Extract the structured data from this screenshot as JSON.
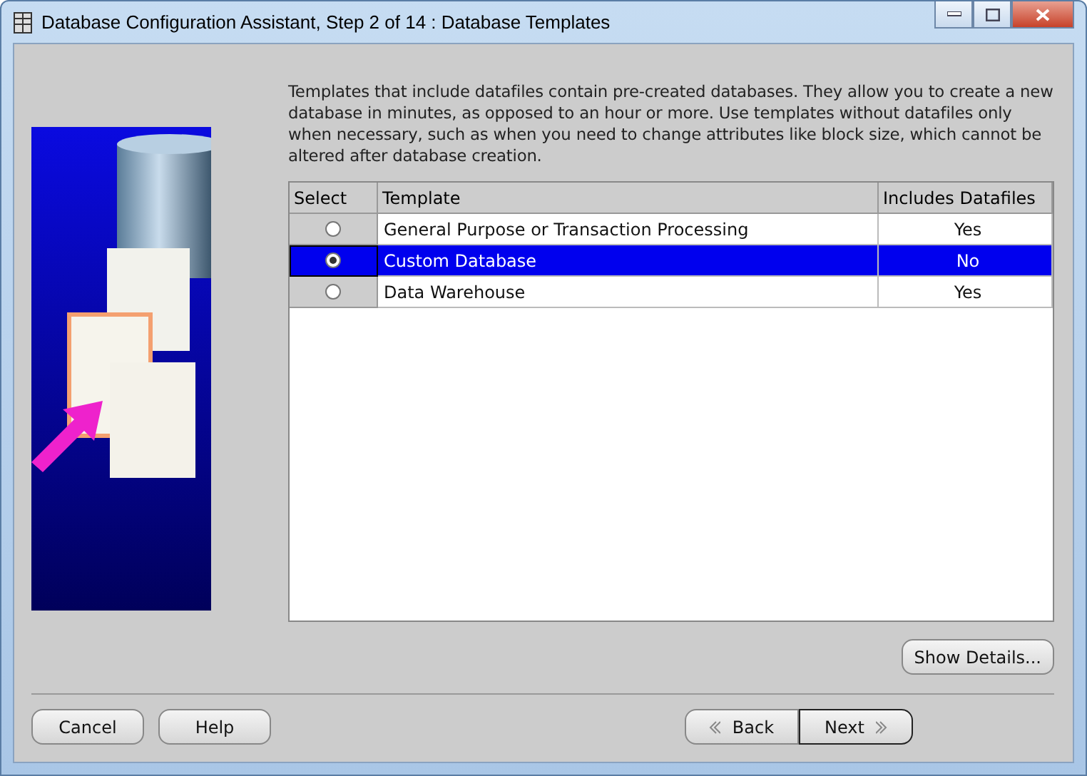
{
  "window": {
    "title": "Database Configuration Assistant, Step 2 of 14 : Database Templates"
  },
  "description": "Templates that include datafiles contain pre-created databases. They allow you to create a new database in minutes, as opposed to an hour or more. Use templates without datafiles only when necessary, such as when you need to change attributes like block size, which cannot be altered after database creation.",
  "illustration": {
    "kind": "picture"
  },
  "table": {
    "columns": [
      "Select",
      "Template",
      "Includes Datafiles"
    ],
    "rows": [
      {
        "template": "General Purpose or Transaction Processing",
        "includes_datafiles": "Yes",
        "selected": false
      },
      {
        "template": "Custom Database",
        "includes_datafiles": "No",
        "selected": true
      },
      {
        "template": "Data Warehouse",
        "includes_datafiles": "Yes",
        "selected": false
      }
    ]
  },
  "show_details_button": "Show Details...",
  "buttons_left": [
    "Cancel",
    "Help"
  ],
  "back_button": "Back",
  "next_button": "Next"
}
